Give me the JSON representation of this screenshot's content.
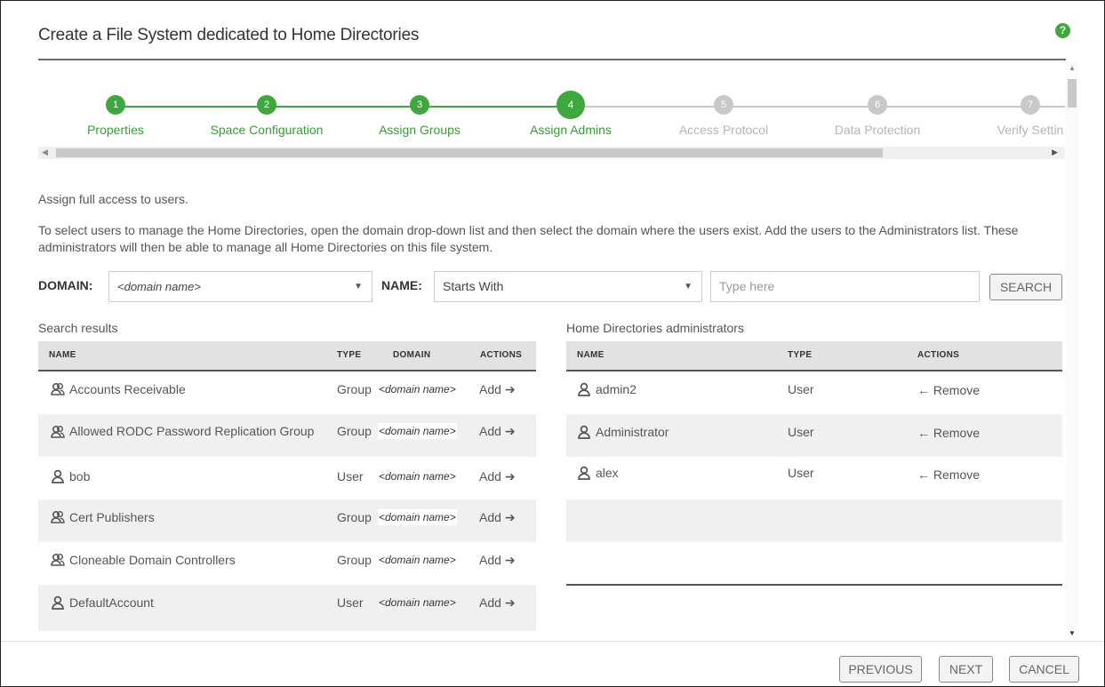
{
  "dialog": {
    "title": "Create a File System dedicated to Home Directories",
    "help": "?"
  },
  "steps": [
    {
      "num": "1",
      "label": "Properties",
      "state": "done"
    },
    {
      "num": "2",
      "label": "Space Configuration",
      "state": "done"
    },
    {
      "num": "3",
      "label": "Assign Groups",
      "state": "done"
    },
    {
      "num": "4",
      "label": "Assign Admins",
      "state": "current"
    },
    {
      "num": "5",
      "label": "Access Protocol",
      "state": "future"
    },
    {
      "num": "6",
      "label": "Data Protection",
      "state": "future"
    },
    {
      "num": "7",
      "label": "Verify Settin",
      "state": "future"
    }
  ],
  "intro": "Assign full access to users.",
  "description": "To select users to manage the Home Directories, open the domain drop-down list and then select the domain where the users exist. Add the users to the Administrators list. These administrators will then be able to manage all Home Directories on this file system.",
  "filter": {
    "domain_label": "DOMAIN:",
    "domain_value": "<domain name>",
    "name_label": "NAME:",
    "name_mode": "Starts With",
    "search_placeholder": "Type here",
    "search_button": "SEARCH"
  },
  "search_results": {
    "title": "Search results",
    "columns": {
      "name": "NAME",
      "type": "TYPE",
      "domain": "DOMAIN",
      "actions": "ACTIONS"
    },
    "rows": [
      {
        "name": "Accounts Receivable",
        "type": "Group",
        "domain": "<domain name>",
        "action": "Add",
        "icon": "group-icon"
      },
      {
        "name": "Allowed RODC Password Replication Group",
        "type": "Group",
        "domain": "<domain name>",
        "action": "Add",
        "icon": "group-icon"
      },
      {
        "name": "bob",
        "type": "User",
        "domain": "<domain name>",
        "action": "Add",
        "icon": "user-icon"
      },
      {
        "name": "Cert Publishers",
        "type": "Group",
        "domain": "<domain name>",
        "action": "Add",
        "icon": "group-icon"
      },
      {
        "name": "Cloneable Domain Controllers",
        "type": "Group",
        "domain": "<domain name>",
        "action": "Add",
        "icon": "group-icon"
      },
      {
        "name": "DefaultAccount",
        "type": "User",
        "domain": "<domain name>",
        "action": "Add",
        "icon": "user-icon"
      }
    ]
  },
  "admins": {
    "title": "Home Directories administrators",
    "columns": {
      "name": "NAME",
      "type": "TYPE",
      "actions": "ACTIONS"
    },
    "rows": [
      {
        "name": "admin2",
        "type": "User",
        "action": "Remove",
        "icon": "user-icon"
      },
      {
        "name": "Administrator",
        "type": "User",
        "action": "Remove",
        "icon": "user-icon"
      },
      {
        "name": "alex",
        "type": "User",
        "action": "Remove",
        "icon": "user-icon"
      }
    ]
  },
  "footer": {
    "previous": "PREVIOUS",
    "next": "NEXT",
    "cancel": "CANCEL"
  },
  "colors": {
    "accent_green": "#3ea83e",
    "link_blue": "#3b8fd6",
    "step_inactive": "#c8c8c8"
  }
}
